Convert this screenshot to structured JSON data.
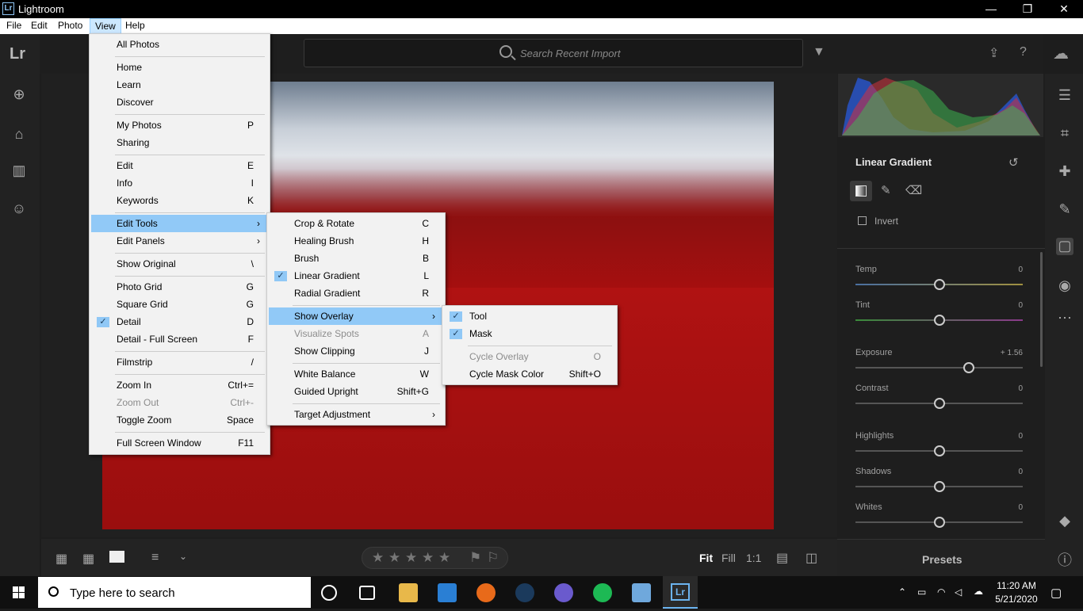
{
  "window": {
    "title": "Lightroom",
    "logo": "Lr",
    "min": "—",
    "max": "❐",
    "close": "✕"
  },
  "menubar": [
    "File",
    "Edit",
    "Photo",
    "View",
    "Help"
  ],
  "search": {
    "placeholder": "Search Recent Import"
  },
  "view_menu": {
    "items": [
      {
        "label": "All Photos",
        "shortcut": ""
      },
      {
        "label": "Home",
        "shortcut": ""
      },
      {
        "label": "Learn",
        "shortcut": ""
      },
      {
        "label": "Discover",
        "shortcut": ""
      },
      {
        "label": "My Photos",
        "shortcut": "P"
      },
      {
        "label": "Sharing",
        "shortcut": ""
      },
      {
        "label": "Edit",
        "shortcut": "E"
      },
      {
        "label": "Info",
        "shortcut": "I"
      },
      {
        "label": "Keywords",
        "shortcut": "K"
      },
      {
        "label": "Edit Tools",
        "shortcut": ""
      },
      {
        "label": "Edit Panels",
        "shortcut": ""
      },
      {
        "label": "Show Original",
        "shortcut": "\\"
      },
      {
        "label": "Photo Grid",
        "shortcut": "G"
      },
      {
        "label": "Square Grid",
        "shortcut": "G"
      },
      {
        "label": "Detail",
        "shortcut": "D"
      },
      {
        "label": "Detail - Full Screen",
        "shortcut": "F"
      },
      {
        "label": "Filmstrip",
        "shortcut": "/"
      },
      {
        "label": "Zoom In",
        "shortcut": "Ctrl+="
      },
      {
        "label": "Zoom Out",
        "shortcut": "Ctrl+-"
      },
      {
        "label": "Toggle Zoom",
        "shortcut": "Space"
      },
      {
        "label": "Full Screen Window",
        "shortcut": "F11"
      }
    ]
  },
  "edit_tools_menu": {
    "items": [
      {
        "label": "Crop & Rotate",
        "shortcut": "C"
      },
      {
        "label": "Healing Brush",
        "shortcut": "H"
      },
      {
        "label": "Brush",
        "shortcut": "B"
      },
      {
        "label": "Linear Gradient",
        "shortcut": "L"
      },
      {
        "label": "Radial Gradient",
        "shortcut": "R"
      },
      {
        "label": "Show Overlay",
        "shortcut": ""
      },
      {
        "label": "Visualize Spots",
        "shortcut": "A"
      },
      {
        "label": "Show Clipping",
        "shortcut": "J"
      },
      {
        "label": "White Balance",
        "shortcut": "W"
      },
      {
        "label": "Guided Upright",
        "shortcut": "Shift+G"
      },
      {
        "label": "Target Adjustment",
        "shortcut": ""
      }
    ]
  },
  "overlay_menu": {
    "items": [
      {
        "label": "Tool",
        "shortcut": ""
      },
      {
        "label": "Mask",
        "shortcut": ""
      },
      {
        "label": "Cycle Overlay",
        "shortcut": "O"
      },
      {
        "label": "Cycle Mask Color",
        "shortcut": "Shift+O"
      }
    ]
  },
  "panel": {
    "title": "Linear Gradient",
    "invert_label": "Invert",
    "sliders": [
      {
        "label": "Temp",
        "value": "0",
        "level": 0.5
      },
      {
        "label": "Tint",
        "value": "0",
        "level": 0.5
      },
      {
        "label": "Exposure",
        "value": "+ 1.56",
        "level": 0.68
      },
      {
        "label": "Contrast",
        "value": "0",
        "level": 0.5
      },
      {
        "label": "Highlights",
        "value": "0",
        "level": 0.5
      },
      {
        "label": "Shadows",
        "value": "0",
        "level": 0.5
      },
      {
        "label": "Whites",
        "value": "0",
        "level": 0.5
      }
    ],
    "presets_label": "Presets"
  },
  "bottombar": {
    "fit": "Fit",
    "fill": "Fill",
    "one_to_one": "1:1"
  },
  "taskbar": {
    "search_placeholder": "Type here to search",
    "time": "11:20 AM",
    "date": "5/21/2020"
  },
  "colors": {
    "menu_highlight": "#91c9f7",
    "mask_red": "#a80f0f"
  }
}
